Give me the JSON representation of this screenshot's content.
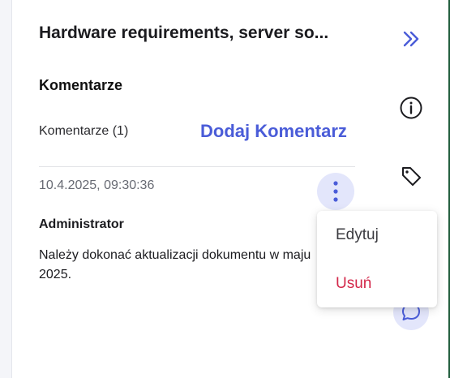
{
  "panel": {
    "title": "Hardware requirements, server so...",
    "section_heading": "Komentarze",
    "comments_count_label": "Komentarze (1)",
    "add_comment_label": "Dodaj Komentarz"
  },
  "comment": {
    "timestamp": "10.4.2025, 09:30:36",
    "author": "Administrator",
    "text": "Należy dokonać aktualizacji dokumentu w maju 2025."
  },
  "context_menu": {
    "edit_label": "Edytuj",
    "delete_label": "Usuń"
  },
  "side_icons": [
    "chevron-double-right-icon",
    "info-icon",
    "tag-icon",
    "chat-icon"
  ],
  "colors": {
    "accent": "#4a5cd8",
    "accent_light": "#e3e6fb",
    "danger": "#d3284a",
    "text": "#1b1b1f",
    "muted": "#676a73"
  }
}
